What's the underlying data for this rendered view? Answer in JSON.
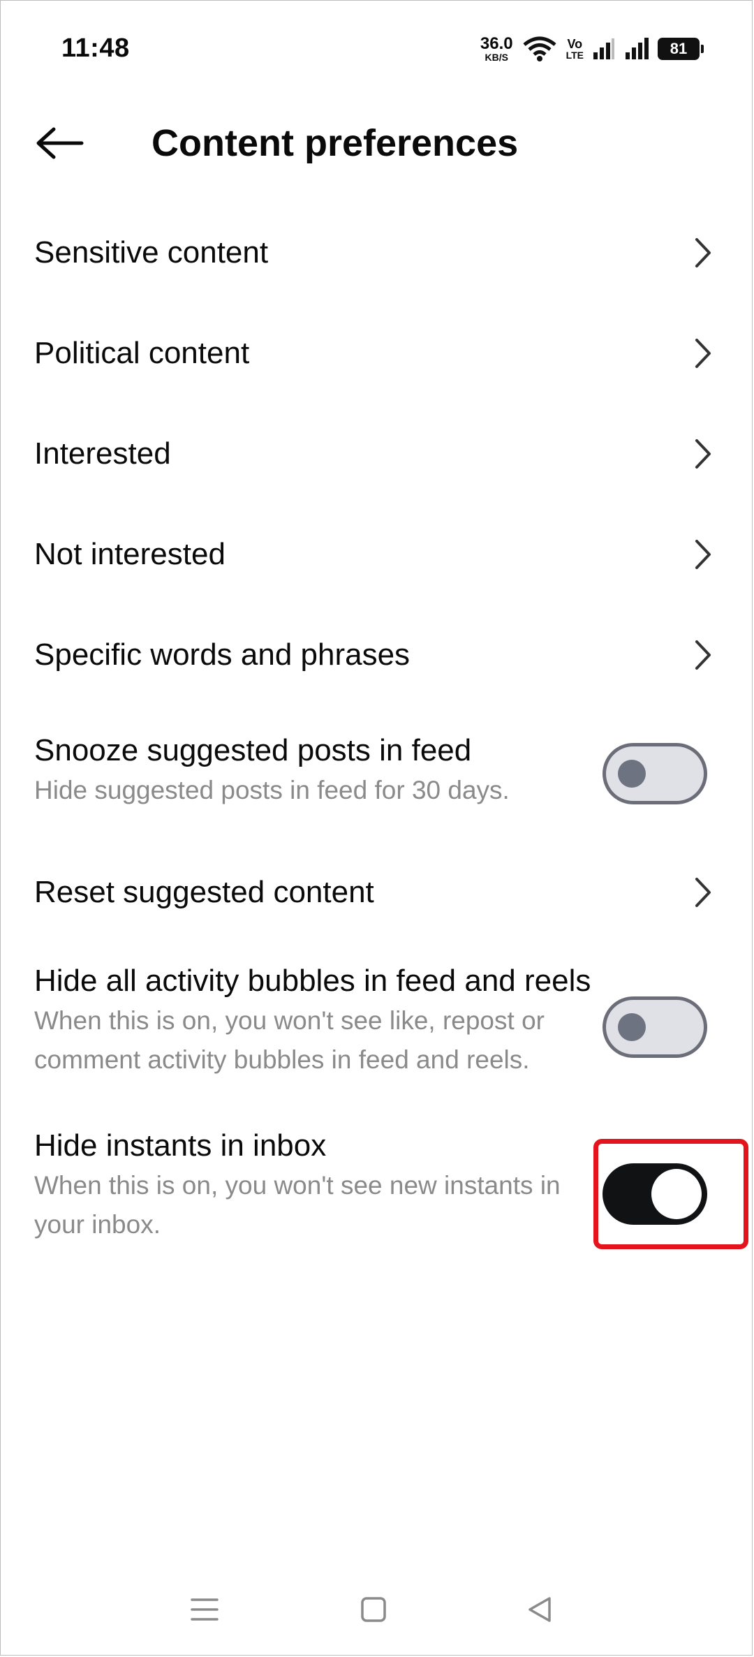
{
  "status_bar": {
    "time": "11:48",
    "net_speed_value": "36.0",
    "net_speed_unit": "KB/S",
    "volte_top": "Vo",
    "volte_bottom": "LTE",
    "battery": "81"
  },
  "header": {
    "title": "Content preferences",
    "back_icon": "arrow-left-icon"
  },
  "items": [
    {
      "label": "Sensitive content",
      "kind": "nav"
    },
    {
      "label": "Political content",
      "kind": "nav"
    },
    {
      "label": "Interested",
      "kind": "nav"
    },
    {
      "label": "Not interested",
      "kind": "nav"
    },
    {
      "label": "Specific words and phrases",
      "kind": "nav"
    },
    {
      "label": "Snooze suggested posts in feed",
      "sub": "Hide suggested posts in feed for 30 days.",
      "kind": "toggle",
      "on": false
    },
    {
      "label": "Reset suggested content",
      "kind": "nav"
    },
    {
      "label": "Hide all activity bubbles in feed and reels",
      "sub": "When this is on, you won't see like, repost or comment activity bubbles in feed and reels.",
      "kind": "toggle",
      "on": false
    },
    {
      "label": "Hide instants in inbox",
      "sub": "When this is on, you won't see new instants in your inbox.",
      "kind": "toggle",
      "on": true,
      "highlighted": true
    }
  ],
  "colors": {
    "highlight": "#e3141b",
    "toggle_on": "#111214",
    "toggle_off_track": "#dfe1e6",
    "subtext": "#8a8a8a"
  },
  "navbar": {
    "icons": [
      "menu-icon",
      "home-square-icon",
      "back-triangle-icon"
    ]
  }
}
